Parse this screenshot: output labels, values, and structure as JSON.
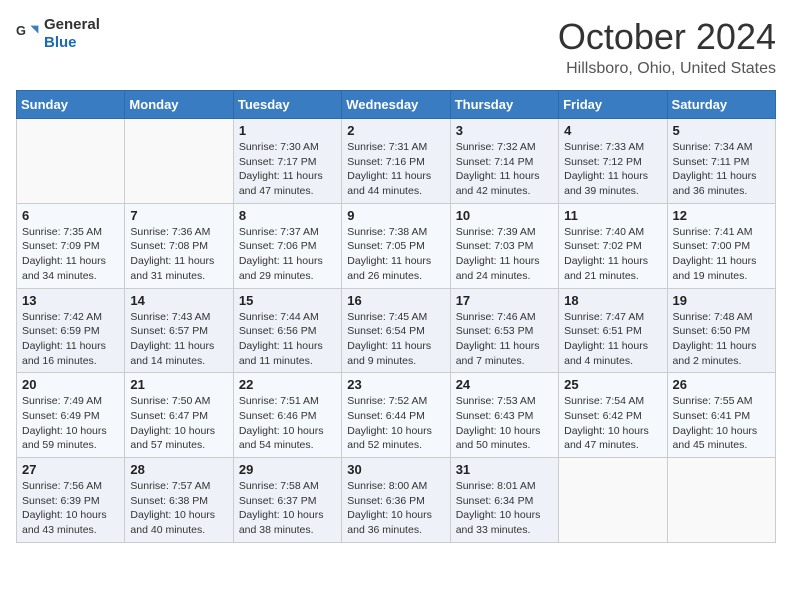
{
  "header": {
    "logo_general": "General",
    "logo_blue": "Blue",
    "title": "October 2024",
    "location": "Hillsboro, Ohio, United States"
  },
  "days_of_week": [
    "Sunday",
    "Monday",
    "Tuesday",
    "Wednesday",
    "Thursday",
    "Friday",
    "Saturday"
  ],
  "weeks": [
    [
      {
        "day": "",
        "info": ""
      },
      {
        "day": "",
        "info": ""
      },
      {
        "day": "1",
        "info": "Sunrise: 7:30 AM\nSunset: 7:17 PM\nDaylight: 11 hours and 47 minutes."
      },
      {
        "day": "2",
        "info": "Sunrise: 7:31 AM\nSunset: 7:16 PM\nDaylight: 11 hours and 44 minutes."
      },
      {
        "day": "3",
        "info": "Sunrise: 7:32 AM\nSunset: 7:14 PM\nDaylight: 11 hours and 42 minutes."
      },
      {
        "day": "4",
        "info": "Sunrise: 7:33 AM\nSunset: 7:12 PM\nDaylight: 11 hours and 39 minutes."
      },
      {
        "day": "5",
        "info": "Sunrise: 7:34 AM\nSunset: 7:11 PM\nDaylight: 11 hours and 36 minutes."
      }
    ],
    [
      {
        "day": "6",
        "info": "Sunrise: 7:35 AM\nSunset: 7:09 PM\nDaylight: 11 hours and 34 minutes."
      },
      {
        "day": "7",
        "info": "Sunrise: 7:36 AM\nSunset: 7:08 PM\nDaylight: 11 hours and 31 minutes."
      },
      {
        "day": "8",
        "info": "Sunrise: 7:37 AM\nSunset: 7:06 PM\nDaylight: 11 hours and 29 minutes."
      },
      {
        "day": "9",
        "info": "Sunrise: 7:38 AM\nSunset: 7:05 PM\nDaylight: 11 hours and 26 minutes."
      },
      {
        "day": "10",
        "info": "Sunrise: 7:39 AM\nSunset: 7:03 PM\nDaylight: 11 hours and 24 minutes."
      },
      {
        "day": "11",
        "info": "Sunrise: 7:40 AM\nSunset: 7:02 PM\nDaylight: 11 hours and 21 minutes."
      },
      {
        "day": "12",
        "info": "Sunrise: 7:41 AM\nSunset: 7:00 PM\nDaylight: 11 hours and 19 minutes."
      }
    ],
    [
      {
        "day": "13",
        "info": "Sunrise: 7:42 AM\nSunset: 6:59 PM\nDaylight: 11 hours and 16 minutes."
      },
      {
        "day": "14",
        "info": "Sunrise: 7:43 AM\nSunset: 6:57 PM\nDaylight: 11 hours and 14 minutes."
      },
      {
        "day": "15",
        "info": "Sunrise: 7:44 AM\nSunset: 6:56 PM\nDaylight: 11 hours and 11 minutes."
      },
      {
        "day": "16",
        "info": "Sunrise: 7:45 AM\nSunset: 6:54 PM\nDaylight: 11 hours and 9 minutes."
      },
      {
        "day": "17",
        "info": "Sunrise: 7:46 AM\nSunset: 6:53 PM\nDaylight: 11 hours and 7 minutes."
      },
      {
        "day": "18",
        "info": "Sunrise: 7:47 AM\nSunset: 6:51 PM\nDaylight: 11 hours and 4 minutes."
      },
      {
        "day": "19",
        "info": "Sunrise: 7:48 AM\nSunset: 6:50 PM\nDaylight: 11 hours and 2 minutes."
      }
    ],
    [
      {
        "day": "20",
        "info": "Sunrise: 7:49 AM\nSunset: 6:49 PM\nDaylight: 10 hours and 59 minutes."
      },
      {
        "day": "21",
        "info": "Sunrise: 7:50 AM\nSunset: 6:47 PM\nDaylight: 10 hours and 57 minutes."
      },
      {
        "day": "22",
        "info": "Sunrise: 7:51 AM\nSunset: 6:46 PM\nDaylight: 10 hours and 54 minutes."
      },
      {
        "day": "23",
        "info": "Sunrise: 7:52 AM\nSunset: 6:44 PM\nDaylight: 10 hours and 52 minutes."
      },
      {
        "day": "24",
        "info": "Sunrise: 7:53 AM\nSunset: 6:43 PM\nDaylight: 10 hours and 50 minutes."
      },
      {
        "day": "25",
        "info": "Sunrise: 7:54 AM\nSunset: 6:42 PM\nDaylight: 10 hours and 47 minutes."
      },
      {
        "day": "26",
        "info": "Sunrise: 7:55 AM\nSunset: 6:41 PM\nDaylight: 10 hours and 45 minutes."
      }
    ],
    [
      {
        "day": "27",
        "info": "Sunrise: 7:56 AM\nSunset: 6:39 PM\nDaylight: 10 hours and 43 minutes."
      },
      {
        "day": "28",
        "info": "Sunrise: 7:57 AM\nSunset: 6:38 PM\nDaylight: 10 hours and 40 minutes."
      },
      {
        "day": "29",
        "info": "Sunrise: 7:58 AM\nSunset: 6:37 PM\nDaylight: 10 hours and 38 minutes."
      },
      {
        "day": "30",
        "info": "Sunrise: 8:00 AM\nSunset: 6:36 PM\nDaylight: 10 hours and 36 minutes."
      },
      {
        "day": "31",
        "info": "Sunrise: 8:01 AM\nSunset: 6:34 PM\nDaylight: 10 hours and 33 minutes."
      },
      {
        "day": "",
        "info": ""
      },
      {
        "day": "",
        "info": ""
      }
    ]
  ]
}
